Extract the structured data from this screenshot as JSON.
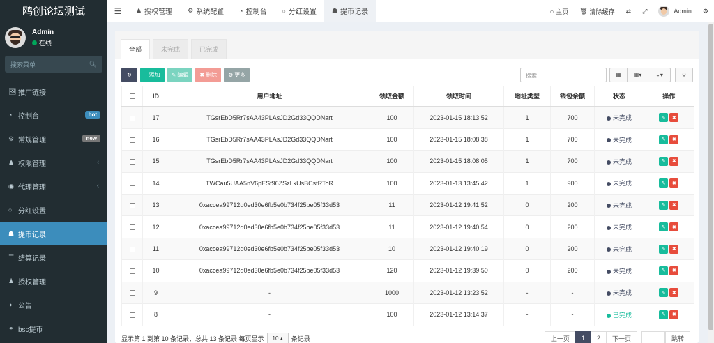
{
  "app": {
    "title": "鸥创论坛测试"
  },
  "user": {
    "name": "Admin",
    "status": "在线"
  },
  "sidebar": {
    "search_placeholder": "搜索菜单",
    "items": [
      {
        "label": "推广链接",
        "icon": "link-icon"
      },
      {
        "label": "控制台",
        "icon": "dashboard-icon",
        "badge": "hot"
      },
      {
        "label": "常规管理",
        "icon": "cogs-icon",
        "badge": "new"
      },
      {
        "label": "权限管理",
        "icon": "group-icon",
        "has_children": true
      },
      {
        "label": "代理管理",
        "icon": "user-circle-icon",
        "has_children": true
      },
      {
        "label": "分红设置",
        "icon": "circle-icon"
      },
      {
        "label": "提币记录",
        "icon": "bank-icon",
        "active": true
      },
      {
        "label": "结算记录",
        "icon": "list-icon"
      },
      {
        "label": "授权管理",
        "icon": "users-icon"
      },
      {
        "label": "公告",
        "icon": "adjust-icon"
      },
      {
        "label": "bsc提币",
        "icon": "bicycle-icon"
      }
    ]
  },
  "topbar": {
    "tabs": [
      {
        "label": "授权管理",
        "icon": "users-icon"
      },
      {
        "label": "系统配置",
        "icon": "gear-icon"
      },
      {
        "label": "控制台",
        "icon": "dashboard-icon"
      },
      {
        "label": "分红设置",
        "icon": "circle-icon"
      },
      {
        "label": "提币记录",
        "icon": "bank-icon",
        "active": true
      }
    ],
    "home": "主页",
    "clear_cache": "清除缓存",
    "user": "Admin"
  },
  "panel": {
    "tabs": [
      "全部",
      "未完成",
      "已完成"
    ],
    "toolbar": {
      "add": "添加",
      "edit": "编辑",
      "delete": "删除",
      "more": "更多"
    },
    "search_placeholder": "搜索"
  },
  "table": {
    "headers": [
      "ID",
      "用户地址",
      "领取金额",
      "领取时间",
      "地址类型",
      "钱包余额",
      "状态",
      "操作"
    ],
    "rows": [
      {
        "id": "17",
        "address": "TGsrEbD5Rr7sAA43PLAsJD2Gd33QQDNart",
        "amount": "100",
        "time": "2023-01-15 18:13:52",
        "type": "1",
        "balance": "700",
        "status": "未完成"
      },
      {
        "id": "16",
        "address": "TGsrEbD5Rr7sAA43PLAsJD2Gd33QQDNart",
        "amount": "100",
        "time": "2023-01-15 18:08:38",
        "type": "1",
        "balance": "700",
        "status": "未完成"
      },
      {
        "id": "15",
        "address": "TGsrEbD5Rr7sAA43PLAsJD2Gd33QQDNart",
        "amount": "100",
        "time": "2023-01-15 18:08:05",
        "type": "1",
        "balance": "700",
        "status": "未完成"
      },
      {
        "id": "14",
        "address": "TWCau5UAA5nV6pESf96ZSzLkUsBCstRToR",
        "amount": "100",
        "time": "2023-01-13 13:45:42",
        "type": "1",
        "balance": "900",
        "status": "未完成"
      },
      {
        "id": "13",
        "address": "0xaccea99712d0ed30e6fb5e0b734f25be05f33d53",
        "amount": "11",
        "time": "2023-01-12 19:41:52",
        "type": "0",
        "balance": "200",
        "status": "未完成"
      },
      {
        "id": "12",
        "address": "0xaccea99712d0ed30e6fb5e0b734f25be05f33d53",
        "amount": "11",
        "time": "2023-01-12 19:40:54",
        "type": "0",
        "balance": "200",
        "status": "未完成"
      },
      {
        "id": "11",
        "address": "0xaccea99712d0ed30e6fb5e0b734f25be05f33d53",
        "amount": "10",
        "time": "2023-01-12 19:40:19",
        "type": "0",
        "balance": "200",
        "status": "未完成"
      },
      {
        "id": "10",
        "address": "0xaccea99712d0ed30e6fb5e0b734f25be05f33d53",
        "amount": "120",
        "time": "2023-01-12 19:39:50",
        "type": "0",
        "balance": "200",
        "status": "未完成"
      },
      {
        "id": "9",
        "address": "-",
        "amount": "1000",
        "time": "2023-01-12 13:23:52",
        "type": "-",
        "balance": "-",
        "status": "未完成"
      },
      {
        "id": "8",
        "address": "-",
        "amount": "100",
        "time": "2023-01-12 13:14:37",
        "type": "-",
        "balance": "-",
        "status": "已完成"
      }
    ]
  },
  "footer": {
    "summary": "显示第 1 到第 10 条记录，总共 13 条记录 每页显示",
    "page_size": "10",
    "suffix": "条记录",
    "prev": "上一页",
    "pages": [
      "1",
      "2"
    ],
    "current_page": "1",
    "next": "下一页",
    "go": "跳转"
  },
  "colors": {
    "sidebar_bg": "#222d32",
    "active_blue": "#3c8dbc",
    "primary_dark": "#444c63",
    "success": "#18bc9c",
    "danger": "#e74c3c"
  }
}
